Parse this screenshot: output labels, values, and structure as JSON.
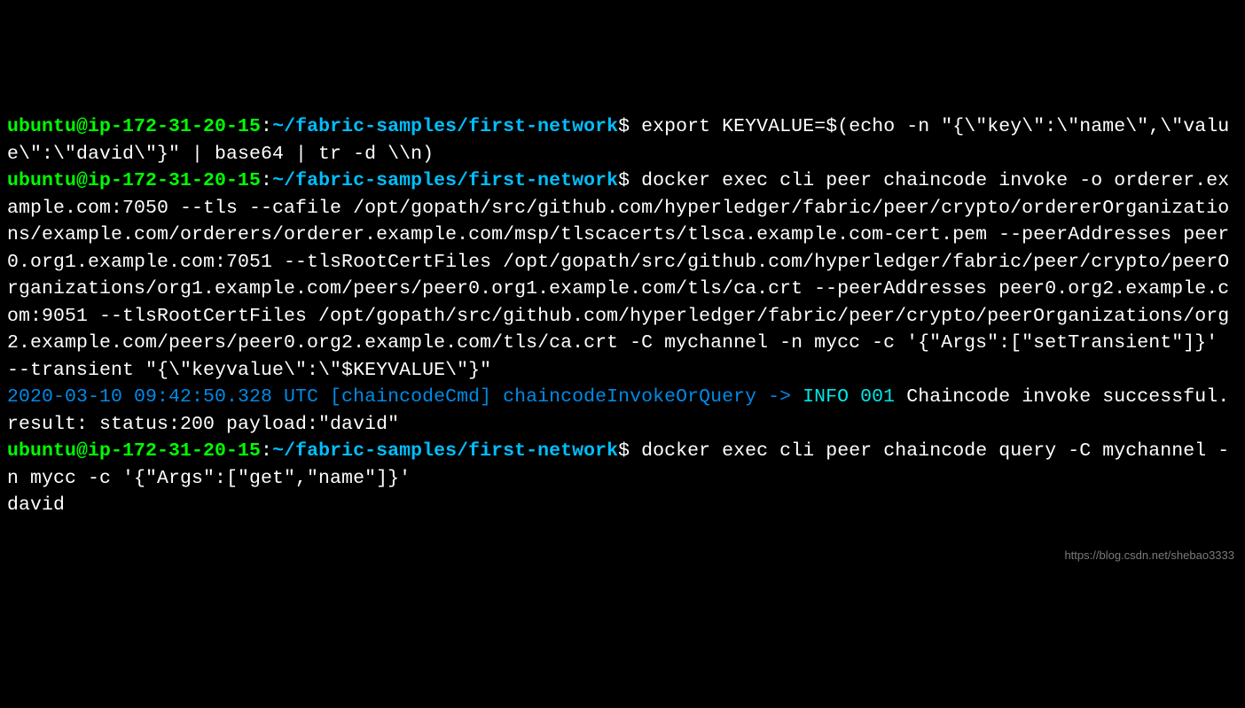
{
  "prompt_user": "ubuntu@ip-172-31-20-15",
  "prompt_sep1": ":",
  "prompt_path": "~/fabric-samples/first-network",
  "prompt_sep2": "$",
  "cmd1": " export KEYVALUE=$(echo -n \"{\\\"key\\\":\\\"name\\\",\\\"value\\\":\\\"david\\\"}\" | base64 | tr -d \\\\n)",
  "cmd2": " docker exec cli peer chaincode invoke -o orderer.example.com:7050 --tls --cafile /opt/gopath/src/github.com/hyperledger/fabric/peer/crypto/ordererOrganizations/example.com/orderers/orderer.example.com/msp/tlscacerts/tlsca.example.com-cert.pem --peerAddresses peer0.org1.example.com:7051 --tlsRootCertFiles /opt/gopath/src/github.com/hyperledger/fabric/peer/crypto/peerOrganizations/org1.example.com/peers/peer0.org1.example.com/tls/ca.crt --peerAddresses peer0.org2.example.com:9051 --tlsRootCertFiles /opt/gopath/src/github.com/hyperledger/fabric/peer/crypto/peerOrganizations/org2.example.com/peers/peer0.org2.example.com/tls/ca.crt -C mychannel -n mycc -c '{\"Args\":[\"setTransient\"]}' --transient \"{\\\"keyvalue\\\":\\\"$KEYVALUE\\\"}\"",
  "log_prefix": "2020-03-10 09:42:50.328 UTC [chaincodeCmd] chaincodeInvokeOrQuery -> ",
  "log_level": "INFO 001",
  "log_msg": " Chaincode invoke successful. result: status:200 payload:\"david\"",
  "cmd3": " docker exec cli peer chaincode query -C mychannel -n mycc -c '{\"Args\":[\"get\",\"name\"]}'",
  "output3": "david",
  "watermark": "https://blog.csdn.net/shebao3333"
}
